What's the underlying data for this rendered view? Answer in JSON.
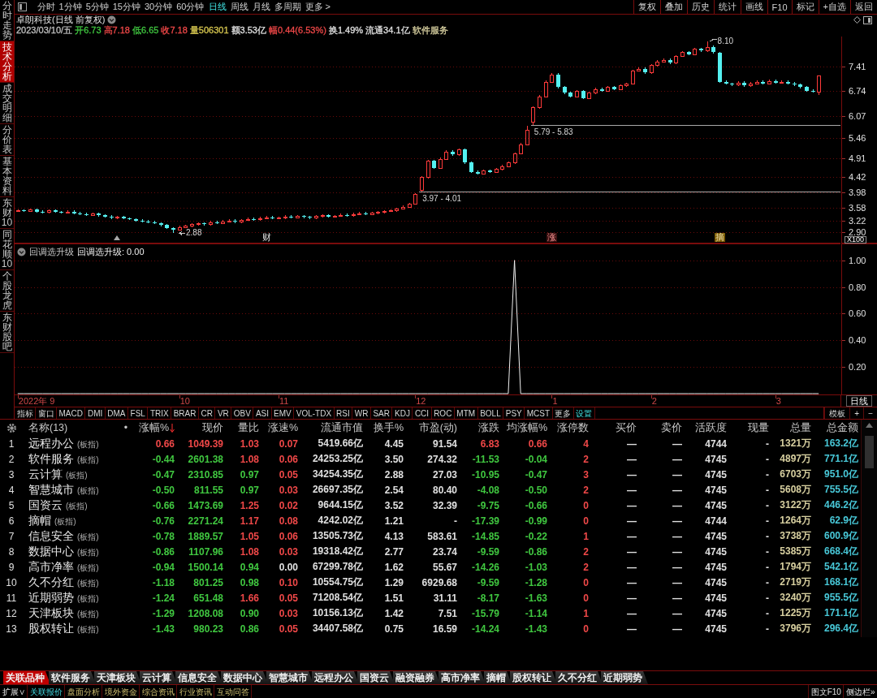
{
  "sidebar": {
    "tabs": [
      {
        "label": "分时走势",
        "selected": false
      },
      {
        "label": "技术分析",
        "selected": true
      },
      {
        "label": "成交明细",
        "selected": false
      },
      {
        "label": "分价表",
        "selected": false
      },
      {
        "label": "基本资料",
        "selected": false
      },
      {
        "label": "东财10",
        "selected": false
      },
      {
        "label": "同花顺10",
        "selected": false
      },
      {
        "label": "个股龙虎",
        "selected": false
      },
      {
        "label": "东财股吧",
        "selected": false
      }
    ]
  },
  "toolbar": {
    "periods": [
      {
        "label": "分时",
        "selected": false
      },
      {
        "label": "1分钟",
        "selected": false
      },
      {
        "label": "5分钟",
        "selected": false
      },
      {
        "label": "15分钟",
        "selected": false
      },
      {
        "label": "30分钟",
        "selected": false
      },
      {
        "label": "60分钟",
        "selected": false
      },
      {
        "label": "日线",
        "selected": true
      },
      {
        "label": "周线",
        "selected": false
      },
      {
        "label": "月线",
        "selected": false
      },
      {
        "label": "多周期",
        "selected": false
      },
      {
        "label": "更多 >",
        "selected": false
      }
    ],
    "actions": [
      "复权",
      "叠加",
      "历史",
      "统计",
      "画线",
      "F10",
      "标记",
      "+自选",
      "返回"
    ]
  },
  "quote": {
    "title": "卓朗科技(日线 前复权)",
    "items": [
      {
        "text": "2023/03/10/五",
        "color": "#c0c0c0"
      },
      {
        "text": "开6.73",
        "color": "#40c840"
      },
      {
        "text": "高7.18",
        "color": "#f04848"
      },
      {
        "text": "低6.65",
        "color": "#40c840"
      },
      {
        "text": "收7.18",
        "color": "#f04848"
      },
      {
        "text": "量506301",
        "color": "#d8c850"
      },
      {
        "text": "额3.53亿",
        "color": "#e0e0e0"
      },
      {
        "text": "幅0.44(6.53%)",
        "color": "#f04848"
      },
      {
        "text": "换1.49%",
        "color": "#e0e0e0"
      },
      {
        "text": "流通34.1亿",
        "color": "#e0e0e0"
      },
      {
        "text": "软件服务",
        "color": "#d8d0a0"
      }
    ]
  },
  "price_chart": {
    "chart_data": {
      "type": "candlestick",
      "ohlc": [
        [
          3.48,
          3.53,
          3.45,
          3.5
        ],
        [
          3.5,
          3.53,
          3.45,
          3.48
        ],
        [
          3.48,
          3.55,
          3.45,
          3.52
        ],
        [
          3.52,
          3.55,
          3.44,
          3.47
        ],
        [
          3.47,
          3.5,
          3.42,
          3.45
        ],
        [
          3.45,
          3.53,
          3.42,
          3.5
        ],
        [
          3.5,
          3.53,
          3.43,
          3.46
        ],
        [
          3.46,
          3.49,
          3.41,
          3.44
        ],
        [
          3.44,
          3.5,
          3.41,
          3.47
        ],
        [
          3.47,
          3.5,
          3.39,
          3.42
        ],
        [
          3.42,
          3.45,
          3.37,
          3.4
        ],
        [
          3.4,
          3.43,
          3.35,
          3.38
        ],
        [
          3.38,
          3.44,
          3.35,
          3.41
        ],
        [
          3.41,
          3.44,
          3.33,
          3.36
        ],
        [
          3.36,
          3.39,
          3.3,
          3.33
        ],
        [
          3.33,
          3.36,
          3.27,
          3.3
        ],
        [
          3.3,
          3.35,
          3.27,
          3.32
        ],
        [
          3.32,
          3.35,
          3.25,
          3.28
        ],
        [
          3.28,
          3.31,
          3.23,
          3.26
        ],
        [
          3.26,
          3.29,
          3.19,
          3.22
        ],
        [
          3.22,
          3.25,
          3.17,
          3.2
        ],
        [
          3.2,
          3.23,
          3.15,
          3.18
        ],
        [
          3.18,
          3.21,
          3.12,
          3.15
        ],
        [
          3.15,
          3.18,
          3.07,
          3.1
        ],
        [
          3.1,
          3.13,
          2.99,
          3.02
        ],
        [
          3.02,
          3.05,
          2.88,
          2.98
        ],
        [
          2.98,
          3.08,
          2.95,
          3.05
        ],
        [
          3.05,
          3.11,
          3.02,
          3.08
        ],
        [
          3.08,
          3.15,
          3.05,
          3.12
        ],
        [
          3.12,
          3.18,
          3.09,
          3.15
        ],
        [
          3.15,
          3.18,
          3.09,
          3.12
        ],
        [
          3.12,
          3.21,
          3.09,
          3.18
        ],
        [
          3.18,
          3.21,
          3.13,
          3.16
        ],
        [
          3.16,
          3.23,
          3.13,
          3.2
        ],
        [
          3.2,
          3.25,
          3.17,
          3.22
        ],
        [
          3.22,
          3.25,
          3.16,
          3.19
        ],
        [
          3.19,
          3.27,
          3.16,
          3.24
        ],
        [
          3.24,
          3.3,
          3.21,
          3.27
        ],
        [
          3.27,
          3.3,
          3.22,
          3.25
        ],
        [
          3.25,
          3.32,
          3.22,
          3.29
        ],
        [
          3.29,
          3.34,
          3.26,
          3.31
        ],
        [
          3.31,
          3.34,
          3.25,
          3.28
        ],
        [
          3.28,
          3.33,
          3.25,
          3.3
        ],
        [
          3.3,
          3.36,
          3.27,
          3.33
        ],
        [
          3.33,
          3.36,
          3.28,
          3.31
        ],
        [
          3.31,
          3.38,
          3.28,
          3.35
        ],
        [
          3.35,
          3.38,
          3.29,
          3.32
        ],
        [
          3.32,
          3.35,
          3.27,
          3.3
        ],
        [
          3.3,
          3.37,
          3.27,
          3.34
        ],
        [
          3.34,
          3.39,
          3.31,
          3.36
        ],
        [
          3.36,
          3.39,
          3.3,
          3.33
        ],
        [
          3.33,
          3.38,
          3.3,
          3.35
        ],
        [
          3.35,
          3.41,
          3.32,
          3.38
        ],
        [
          3.38,
          3.41,
          3.33,
          3.36
        ],
        [
          3.36,
          3.43,
          3.33,
          3.4
        ],
        [
          3.4,
          3.45,
          3.37,
          3.42
        ],
        [
          3.42,
          3.45,
          3.36,
          3.39
        ],
        [
          3.39,
          3.46,
          3.36,
          3.43
        ],
        [
          3.43,
          3.48,
          3.4,
          3.45
        ],
        [
          3.45,
          3.51,
          3.42,
          3.48
        ],
        [
          3.48,
          3.53,
          3.45,
          3.5
        ],
        [
          3.5,
          3.58,
          3.47,
          3.55
        ],
        [
          3.55,
          3.63,
          3.52,
          3.6
        ],
        [
          3.6,
          3.71,
          3.57,
          3.68
        ],
        [
          3.68,
          3.97,
          3.65,
          3.95
        ],
        [
          4.06,
          4.43,
          4.01,
          4.4
        ],
        [
          4.4,
          4.88,
          4.37,
          4.85
        ],
        [
          4.85,
          4.88,
          4.62,
          4.65
        ],
        [
          4.65,
          4.93,
          4.62,
          4.9
        ],
        [
          4.9,
          5.13,
          4.87,
          5.1
        ],
        [
          5.1,
          5.13,
          4.99,
          5.02
        ],
        [
          5.02,
          5.18,
          4.99,
          5.15
        ],
        [
          5.15,
          5.18,
          4.77,
          4.8
        ],
        [
          4.8,
          4.83,
          4.52,
          4.55
        ],
        [
          4.55,
          4.58,
          4.47,
          4.5
        ],
        [
          4.5,
          4.61,
          4.47,
          4.58
        ],
        [
          4.58,
          4.61,
          4.52,
          4.55
        ],
        [
          4.55,
          4.65,
          4.52,
          4.62
        ],
        [
          4.62,
          4.73,
          4.59,
          4.7
        ],
        [
          4.7,
          4.83,
          4.67,
          4.8
        ],
        [
          4.8,
          5.08,
          4.77,
          5.05
        ],
        [
          5.05,
          5.33,
          5.02,
          5.3
        ],
        [
          5.3,
          5.79,
          5.27,
          5.7
        ],
        [
          5.9,
          6.33,
          5.83,
          6.3
        ],
        [
          6.3,
          6.63,
          6.27,
          6.6
        ],
        [
          6.6,
          7.03,
          6.57,
          7.0
        ],
        [
          7.0,
          7.23,
          6.97,
          7.2
        ],
        [
          7.2,
          7.23,
          6.82,
          6.85
        ],
        [
          6.85,
          6.88,
          6.67,
          6.7
        ],
        [
          6.7,
          6.73,
          6.57,
          6.6
        ],
        [
          6.6,
          6.78,
          6.57,
          6.75
        ],
        [
          6.75,
          6.78,
          6.52,
          6.55
        ],
        [
          6.55,
          6.73,
          6.52,
          6.7
        ],
        [
          6.7,
          6.83,
          6.67,
          6.8
        ],
        [
          6.8,
          6.83,
          6.72,
          6.75
        ],
        [
          6.75,
          6.88,
          6.72,
          6.85
        ],
        [
          6.85,
          6.88,
          6.77,
          6.8
        ],
        [
          6.8,
          6.93,
          6.77,
          6.9
        ],
        [
          6.9,
          6.98,
          6.87,
          6.95
        ],
        [
          6.95,
          7.33,
          6.92,
          7.3
        ],
        [
          7.3,
          7.38,
          7.27,
          7.35
        ],
        [
          7.35,
          7.38,
          7.22,
          7.25
        ],
        [
          7.25,
          7.48,
          7.22,
          7.45
        ],
        [
          7.45,
          7.58,
          7.42,
          7.55
        ],
        [
          7.55,
          7.63,
          7.52,
          7.6
        ],
        [
          7.6,
          7.63,
          7.49,
          7.52
        ],
        [
          7.52,
          7.73,
          7.49,
          7.7
        ],
        [
          7.7,
          7.83,
          7.67,
          7.8
        ],
        [
          7.8,
          7.83,
          7.72,
          7.75
        ],
        [
          7.75,
          7.93,
          7.72,
          7.9
        ],
        [
          7.9,
          7.93,
          7.82,
          7.85
        ],
        [
          7.85,
          8.1,
          7.82,
          7.95
        ],
        [
          7.95,
          7.98,
          7.77,
          7.8
        ],
        [
          7.78,
          7.81,
          6.97,
          7.0
        ],
        [
          7.0,
          7.03,
          6.92,
          6.95
        ],
        [
          6.95,
          6.98,
          6.89,
          6.92
        ],
        [
          6.92,
          7.01,
          6.89,
          6.98
        ],
        [
          6.98,
          7.01,
          6.87,
          6.9
        ],
        [
          6.9,
          6.99,
          6.87,
          6.96
        ],
        [
          6.96,
          7.03,
          6.93,
          7.0
        ],
        [
          7.0,
          7.03,
          6.92,
          6.95
        ],
        [
          6.95,
          7.05,
          6.92,
          7.02
        ],
        [
          7.02,
          7.05,
          6.95,
          6.98
        ],
        [
          6.98,
          7.03,
          6.95,
          7.0
        ],
        [
          7.0,
          7.03,
          6.93,
          6.96
        ],
        [
          6.96,
          6.99,
          6.89,
          6.92
        ],
        [
          6.92,
          6.95,
          6.82,
          6.85
        ],
        [
          6.85,
          6.88,
          6.73,
          6.76
        ],
        [
          6.76,
          6.79,
          6.71,
          6.74
        ],
        [
          6.73,
          7.18,
          6.65,
          7.18
        ],
        null,
        null,
        null
      ],
      "ylim": [
        2.62,
        8.23
      ],
      "yticks": [
        {
          "value": 7.41,
          "label": "7.41"
        },
        {
          "value": 6.74,
          "label": "6.74"
        },
        {
          "value": 6.07,
          "label": "6.07"
        },
        {
          "value": 5.46,
          "label": "5.46"
        },
        {
          "value": 4.91,
          "label": "4.91"
        },
        {
          "value": 4.42,
          "label": "4.42"
        },
        {
          "value": 3.98,
          "label": "3.98"
        },
        {
          "value": 3.58,
          "label": "3.58"
        },
        {
          "value": 3.22,
          "label": "3.22"
        },
        {
          "value": 2.9,
          "label": "2.90"
        }
      ],
      "grid": true
    },
    "scale_label": "X100",
    "high_label": "8.10",
    "low_label": "2.88",
    "gap_labels": [
      "3.97 - 4.01",
      "5.79 - 5.83"
    ],
    "markers": [
      {
        "text": "财",
        "kind": "info"
      },
      {
        "text": "涨",
        "kind": "limit"
      },
      {
        "text": "摘",
        "kind": "st"
      }
    ]
  },
  "indicator": {
    "reading": "回调选升级: 0.00",
    "chart_data": {
      "type": "line",
      "title": "回调选升级",
      "values": [
        0,
        0,
        0,
        0,
        0,
        0,
        0,
        0,
        0,
        0,
        0,
        0,
        0,
        0,
        0,
        0,
        0,
        0,
        0,
        0,
        0,
        0,
        0,
        0,
        0,
        0,
        0,
        0,
        0,
        0,
        0,
        0,
        0,
        0,
        0,
        0,
        0,
        0,
        0,
        0,
        0,
        0,
        0,
        0,
        0,
        0,
        0,
        0,
        0,
        0,
        0,
        0,
        0,
        0,
        0,
        0,
        0,
        0,
        0,
        0,
        0,
        0,
        0,
        0,
        0,
        0,
        0,
        0,
        0,
        0,
        0,
        0,
        0,
        0,
        0,
        0,
        0,
        0,
        0,
        0,
        1,
        0,
        0,
        0,
        0,
        0,
        0,
        0,
        0,
        0,
        0,
        0,
        0,
        0,
        0,
        0,
        0,
        0,
        0,
        0,
        0,
        0,
        0,
        0,
        0,
        0,
        0,
        0,
        0,
        0,
        0,
        0,
        0,
        0,
        0,
        0,
        0,
        0,
        0,
        0,
        0,
        0,
        0,
        0,
        0,
        0,
        0,
        0,
        0,
        0,
        null,
        null,
        null
      ],
      "ylim": [
        0,
        1.12
      ],
      "yticks": [
        {
          "value": 1,
          "label": "1.00"
        },
        {
          "value": 0.8,
          "label": "0.80"
        },
        {
          "value": 0.6,
          "label": "0.60"
        },
        {
          "value": 0.4,
          "label": "0.40"
        },
        {
          "value": 0.2,
          "label": "0.20"
        }
      ],
      "grid": true
    }
  },
  "date_axis": {
    "labels": [
      "2022年 9",
      "10",
      "11",
      "12",
      "1",
      "2",
      "3"
    ],
    "period": "日线"
  },
  "indicator_tabs": {
    "tabs": [
      {
        "label": "指标",
        "kind": "tab"
      },
      {
        "label": "窗口",
        "kind": "tab"
      },
      {
        "label": "MACD",
        "kind": "tab"
      },
      {
        "label": "DMI",
        "kind": "tab"
      },
      {
        "label": "DMA",
        "kind": "tab"
      },
      {
        "label": "FSL",
        "kind": "tab"
      },
      {
        "label": "TRIX",
        "kind": "tab"
      },
      {
        "label": "BRAR",
        "kind": "tab"
      },
      {
        "label": "CR",
        "kind": "tab"
      },
      {
        "label": "VR",
        "kind": "tab"
      },
      {
        "label": "OBV",
        "kind": "tab"
      },
      {
        "label": "ASI",
        "kind": "tab"
      },
      {
        "label": "EMV",
        "kind": "tab"
      },
      {
        "label": "VOL-TDX",
        "kind": "tab"
      },
      {
        "label": "RSI",
        "kind": "tab"
      },
      {
        "label": "WR",
        "kind": "tab"
      },
      {
        "label": "SAR",
        "kind": "tab"
      },
      {
        "label": "KDJ",
        "kind": "tab"
      },
      {
        "label": "CCI",
        "kind": "tab"
      },
      {
        "label": "ROC",
        "kind": "tab"
      },
      {
        "label": "MTM",
        "kind": "tab"
      },
      {
        "label": "BOLL",
        "kind": "tab"
      },
      {
        "label": "PSY",
        "kind": "tab"
      },
      {
        "label": "MCST",
        "kind": "tab"
      },
      {
        "label": "更多",
        "kind": "tab"
      },
      {
        "label": "设置",
        "kind": "setting"
      }
    ],
    "tools": [
      "模板",
      "+",
      "−"
    ]
  },
  "table": {
    "columns": [
      {
        "label": "名称(13)",
        "sorted": false
      },
      {
        "label": "•",
        "sorted": false
      },
      {
        "label": "涨幅%",
        "sorted": true
      },
      {
        "label": "现价",
        "sorted": false
      },
      {
        "label": "量比",
        "sorted": false
      },
      {
        "label": "涨速%",
        "sorted": false
      },
      {
        "label": "流通市值",
        "sorted": false
      },
      {
        "label": "换手%",
        "sorted": false
      },
      {
        "label": "市盈(动)",
        "sorted": false
      },
      {
        "label": "涨跌",
        "sorted": false
      },
      {
        "label": "均涨幅%",
        "sorted": false
      },
      {
        "label": "涨停数",
        "sorted": false
      },
      {
        "label": "买价",
        "sorted": false
      },
      {
        "label": "卖价",
        "sorted": false
      },
      {
        "label": "活跃度",
        "sorted": false
      },
      {
        "label": "现量",
        "sorted": false
      },
      {
        "label": "总量",
        "sorted": false
      },
      {
        "label": "总金额",
        "sorted": false
      }
    ],
    "rows": [
      {
        "num": "1",
        "cells": [
          {
            "text": "远程办公",
            "tag": "(板指)"
          },
          "",
          {
            "text": "0.66",
            "color": "#f04848"
          },
          {
            "text": "1049.39",
            "color": "#f04848"
          },
          {
            "text": "1.03",
            "color": "#f04848"
          },
          {
            "text": "0.07",
            "color": "#f04848"
          },
          "5419.66亿",
          "4.45",
          "91.54",
          {
            "text": "6.83",
            "color": "#f04848"
          },
          {
            "text": "0.66",
            "color": "#f04848"
          },
          {
            "text": "4",
            "color": "#f04848"
          },
          "—",
          "—",
          "4744",
          "-",
          {
            "text": "1321万",
            "color": "#d8d0a0"
          },
          {
            "text": "163.2亿",
            "color": "#48c8d8"
          }
        ]
      },
      {
        "num": "2",
        "cells": [
          {
            "text": "软件服务",
            "tag": "(板指)"
          },
          "",
          {
            "text": "-0.44",
            "color": "#40c840"
          },
          {
            "text": "2601.38",
            "color": "#40c840"
          },
          {
            "text": "1.08",
            "color": "#f04848"
          },
          {
            "text": "0.06",
            "color": "#f04848"
          },
          "24253.25亿",
          "3.50",
          "274.32",
          {
            "text": "-11.53",
            "color": "#40c840"
          },
          {
            "text": "-0.04",
            "color": "#40c840"
          },
          {
            "text": "2",
            "color": "#f04848"
          },
          "—",
          "—",
          "4745",
          "-",
          {
            "text": "4897万",
            "color": "#d8d0a0"
          },
          {
            "text": "771.1亿",
            "color": "#48c8d8"
          }
        ]
      },
      {
        "num": "3",
        "cells": [
          {
            "text": "云计算",
            "tag": "(板指)"
          },
          "",
          {
            "text": "-0.47",
            "color": "#40c840"
          },
          {
            "text": "2310.85",
            "color": "#40c840"
          },
          {
            "text": "0.97",
            "color": "#40c840"
          },
          {
            "text": "0.05",
            "color": "#f04848"
          },
          "34254.35亿",
          "2.88",
          "27.03",
          {
            "text": "-10.95",
            "color": "#40c840"
          },
          {
            "text": "-0.47",
            "color": "#40c840"
          },
          {
            "text": "3",
            "color": "#f04848"
          },
          "—",
          "—",
          "4745",
          "-",
          {
            "text": "6703万",
            "color": "#d8d0a0"
          },
          {
            "text": "951.0亿",
            "color": "#48c8d8"
          }
        ]
      },
      {
        "num": "4",
        "cells": [
          {
            "text": "智慧城市",
            "tag": "(板指)"
          },
          "",
          {
            "text": "-0.50",
            "color": "#40c840"
          },
          {
            "text": "811.55",
            "color": "#40c840"
          },
          {
            "text": "0.97",
            "color": "#40c840"
          },
          {
            "text": "0.03",
            "color": "#f04848"
          },
          "26697.35亿",
          "2.54",
          "80.40",
          {
            "text": "-4.08",
            "color": "#40c840"
          },
          {
            "text": "-0.50",
            "color": "#40c840"
          },
          {
            "text": "2",
            "color": "#f04848"
          },
          "—",
          "—",
          "4745",
          "-",
          {
            "text": "5608万",
            "color": "#d8d0a0"
          },
          {
            "text": "755.5亿",
            "color": "#48c8d8"
          }
        ]
      },
      {
        "num": "5",
        "cells": [
          {
            "text": "国资云",
            "tag": "(板指)"
          },
          "",
          {
            "text": "-0.66",
            "color": "#40c840"
          },
          {
            "text": "1473.69",
            "color": "#40c840"
          },
          {
            "text": "1.25",
            "color": "#f04848"
          },
          {
            "text": "0.02",
            "color": "#f04848"
          },
          "9644.15亿",
          "3.52",
          "32.39",
          {
            "text": "-9.75",
            "color": "#40c840"
          },
          {
            "text": "-0.66",
            "color": "#40c840"
          },
          {
            "text": "0",
            "color": "#f04848"
          },
          "—",
          "—",
          "4745",
          "-",
          {
            "text": "3122万",
            "color": "#d8d0a0"
          },
          {
            "text": "446.2亿",
            "color": "#48c8d8"
          }
        ]
      },
      {
        "num": "6",
        "cells": [
          {
            "text": "摘帽",
            "tag": "(板指)"
          },
          "",
          {
            "text": "-0.76",
            "color": "#40c840"
          },
          {
            "text": "2271.24",
            "color": "#40c840"
          },
          {
            "text": "1.17",
            "color": "#f04848"
          },
          {
            "text": "0.08",
            "color": "#f04848"
          },
          "4242.02亿",
          "1.21",
          "-",
          {
            "text": "-17.39",
            "color": "#40c840"
          },
          {
            "text": "-0.99",
            "color": "#40c840"
          },
          {
            "text": "0",
            "color": "#f04848"
          },
          "—",
          "—",
          "4744",
          "-",
          {
            "text": "1264万",
            "color": "#d8d0a0"
          },
          {
            "text": "62.9亿",
            "color": "#48c8d8"
          }
        ]
      },
      {
        "num": "7",
        "cells": [
          {
            "text": "信息安全",
            "tag": "(板指)"
          },
          "",
          {
            "text": "-0.78",
            "color": "#40c840"
          },
          {
            "text": "1889.57",
            "color": "#40c840"
          },
          {
            "text": "1.05",
            "color": "#f04848"
          },
          {
            "text": "0.06",
            "color": "#f04848"
          },
          "13505.73亿",
          "4.13",
          "583.61",
          {
            "text": "-14.85",
            "color": "#40c840"
          },
          {
            "text": "-0.22",
            "color": "#40c840"
          },
          {
            "text": "1",
            "color": "#f04848"
          },
          "—",
          "—",
          "4745",
          "-",
          {
            "text": "3738万",
            "color": "#d8d0a0"
          },
          {
            "text": "600.9亿",
            "color": "#48c8d8"
          }
        ]
      },
      {
        "num": "8",
        "cells": [
          {
            "text": "数据中心",
            "tag": "(板指)"
          },
          "",
          {
            "text": "-0.86",
            "color": "#40c840"
          },
          {
            "text": "1107.96",
            "color": "#40c840"
          },
          {
            "text": "1.08",
            "color": "#f04848"
          },
          {
            "text": "0.03",
            "color": "#f04848"
          },
          "19318.42亿",
          "2.77",
          "23.74",
          {
            "text": "-9.59",
            "color": "#40c840"
          },
          {
            "text": "-0.86",
            "color": "#40c840"
          },
          {
            "text": "2",
            "color": "#f04848"
          },
          "—",
          "—",
          "4745",
          "-",
          {
            "text": "5385万",
            "color": "#d8d0a0"
          },
          {
            "text": "668.4亿",
            "color": "#48c8d8"
          }
        ]
      },
      {
        "num": "9",
        "cells": [
          {
            "text": "高市净率",
            "tag": "(板指)"
          },
          "",
          {
            "text": "-0.94",
            "color": "#40c840"
          },
          {
            "text": "1500.14",
            "color": "#40c840"
          },
          {
            "text": "0.94",
            "color": "#40c840"
          },
          {
            "text": "0.00",
            "color": "#e0e0e0"
          },
          "67299.78亿",
          "1.62",
          "55.67",
          {
            "text": "-14.26",
            "color": "#40c840"
          },
          {
            "text": "-1.03",
            "color": "#40c840"
          },
          {
            "text": "2",
            "color": "#f04848"
          },
          "—",
          "—",
          "4745",
          "-",
          {
            "text": "1794万",
            "color": "#d8d0a0"
          },
          {
            "text": "542.1亿",
            "color": "#48c8d8"
          }
        ]
      },
      {
        "num": "10",
        "cells": [
          {
            "text": "久不分红",
            "tag": "(板指)"
          },
          "",
          {
            "text": "-1.18",
            "color": "#40c840"
          },
          {
            "text": "801.25",
            "color": "#40c840"
          },
          {
            "text": "0.98",
            "color": "#40c840"
          },
          {
            "text": "0.10",
            "color": "#f04848"
          },
          "10554.75亿",
          "1.29",
          "6929.68",
          {
            "text": "-9.59",
            "color": "#40c840"
          },
          {
            "text": "-1.28",
            "color": "#40c840"
          },
          {
            "text": "0",
            "color": "#f04848"
          },
          "—",
          "—",
          "4745",
          "-",
          {
            "text": "2719万",
            "color": "#d8d0a0"
          },
          {
            "text": "168.1亿",
            "color": "#48c8d8"
          }
        ]
      },
      {
        "num": "11",
        "cells": [
          {
            "text": "近期弱势",
            "tag": "(板指)"
          },
          "",
          {
            "text": "-1.24",
            "color": "#40c840"
          },
          {
            "text": "651.48",
            "color": "#40c840"
          },
          {
            "text": "1.66",
            "color": "#f04848"
          },
          {
            "text": "0.05",
            "color": "#f04848"
          },
          "71208.54亿",
          "1.51",
          "31.11",
          {
            "text": "-8.17",
            "color": "#40c840"
          },
          {
            "text": "-1.63",
            "color": "#40c840"
          },
          {
            "text": "0",
            "color": "#f04848"
          },
          "—",
          "—",
          "4745",
          "-",
          {
            "text": "3240万",
            "color": "#d8d0a0"
          },
          {
            "text": "955.5亿",
            "color": "#48c8d8"
          }
        ]
      },
      {
        "num": "12",
        "cells": [
          {
            "text": "天津板块",
            "tag": "(板指)"
          },
          "",
          {
            "text": "-1.29",
            "color": "#40c840"
          },
          {
            "text": "1208.08",
            "color": "#40c840"
          },
          {
            "text": "0.90",
            "color": "#40c840"
          },
          {
            "text": "0.03",
            "color": "#f04848"
          },
          "10156.13亿",
          "1.42",
          "7.51",
          {
            "text": "-15.79",
            "color": "#40c840"
          },
          {
            "text": "-1.14",
            "color": "#40c840"
          },
          {
            "text": "1",
            "color": "#f04848"
          },
          "—",
          "—",
          "4745",
          "-",
          {
            "text": "1225万",
            "color": "#d8d0a0"
          },
          {
            "text": "171.1亿",
            "color": "#48c8d8"
          }
        ]
      },
      {
        "num": "13",
        "cells": [
          {
            "text": "股权转让",
            "tag": "(板指)"
          },
          "",
          {
            "text": "-1.43",
            "color": "#40c840"
          },
          {
            "text": "980.23",
            "color": "#40c840"
          },
          {
            "text": "0.86",
            "color": "#40c840"
          },
          {
            "text": "0.05",
            "color": "#f04848"
          },
          "34407.58亿",
          "0.75",
          "16.59",
          {
            "text": "-14.24",
            "color": "#40c840"
          },
          {
            "text": "-1.43",
            "color": "#40c840"
          },
          {
            "text": "0",
            "color": "#f04848"
          },
          "—",
          "—",
          "4745",
          "-",
          {
            "text": "3796万",
            "color": "#d8d0a0"
          },
          {
            "text": "296.4亿",
            "color": "#48c8d8"
          }
        ]
      }
    ]
  },
  "related_tabs": [
    {
      "label": "关联品种",
      "selected": true
    },
    {
      "label": "软件服务",
      "selected": false
    },
    {
      "label": "天津板块",
      "selected": false
    },
    {
      "label": "云计算",
      "selected": false
    },
    {
      "label": "信息安全",
      "selected": false
    },
    {
      "label": "数据中心",
      "selected": false
    },
    {
      "label": "智慧城市",
      "selected": false
    },
    {
      "label": "远程办公",
      "selected": false
    },
    {
      "label": "国资云",
      "selected": false
    },
    {
      "label": "融资融券",
      "selected": false
    },
    {
      "label": "高市净率",
      "selected": false
    },
    {
      "label": "摘帽",
      "selected": false
    },
    {
      "label": "股权转让",
      "selected": false
    },
    {
      "label": "久不分红",
      "selected": false
    },
    {
      "label": "近期弱势",
      "selected": false
    }
  ],
  "status_bar": {
    "expand": "扩展∨",
    "items": [
      {
        "label": "关联报价",
        "selected": true
      },
      {
        "label": "盘面分析",
        "selected": false
      },
      {
        "label": "境外资金",
        "selected": false
      },
      {
        "label": "综合资讯",
        "selected": false
      },
      {
        "label": "行业资讯",
        "selected": false
      },
      {
        "label": "互动问答",
        "selected": false
      }
    ],
    "right": [
      "图文F10",
      "侧边栏»"
    ]
  }
}
